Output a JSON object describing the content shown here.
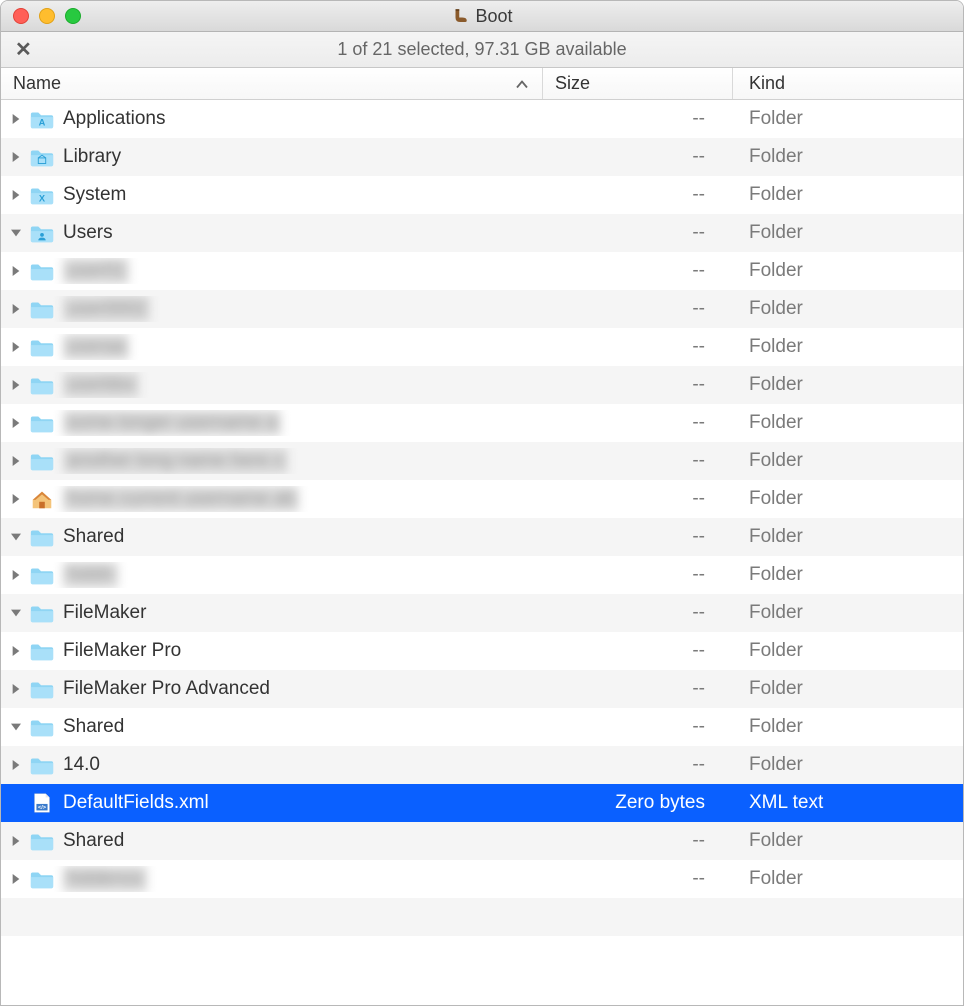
{
  "window": {
    "title": "Boot"
  },
  "status": "1 of 21 selected, 97.31 GB available",
  "columns": {
    "name": "Name",
    "size": "Size",
    "kind": "Kind"
  },
  "kinds": {
    "folder": "Folder",
    "xml": "XML text"
  },
  "sizes": {
    "dash": "--",
    "zero": "Zero bytes"
  },
  "rows": [
    {
      "indent": 0,
      "disc": "right",
      "icon": "folder-app",
      "label": "Applications",
      "blur": false,
      "size": "--",
      "kind": "Folder",
      "sel": false
    },
    {
      "indent": 0,
      "disc": "right",
      "icon": "folder-lib",
      "label": "Library",
      "blur": false,
      "size": "--",
      "kind": "Folder",
      "sel": false
    },
    {
      "indent": 0,
      "disc": "right",
      "icon": "folder-sys",
      "label": "System",
      "blur": false,
      "size": "--",
      "kind": "Folder",
      "sel": false
    },
    {
      "indent": 0,
      "disc": "down",
      "icon": "folder-usr",
      "label": "Users",
      "blur": false,
      "size": "--",
      "kind": "Folder",
      "sel": false
    },
    {
      "indent": 1,
      "disc": "right",
      "icon": "folder",
      "label": "user01",
      "blur": true,
      "size": "--",
      "kind": "Folder",
      "sel": false
    },
    {
      "indent": 1,
      "disc": "right",
      "icon": "folder",
      "label": "user0002",
      "blur": true,
      "size": "--",
      "kind": "Folder",
      "sel": false
    },
    {
      "indent": 1,
      "disc": "right",
      "icon": "folder",
      "label": "useraa",
      "blur": true,
      "size": "--",
      "kind": "Folder",
      "sel": false
    },
    {
      "indent": 1,
      "disc": "right",
      "icon": "folder",
      "label": "userbbx",
      "blur": true,
      "size": "--",
      "kind": "Folder",
      "sel": false
    },
    {
      "indent": 1,
      "disc": "right",
      "icon": "folder",
      "label": "some longer username a",
      "blur": true,
      "size": "--",
      "kind": "Folder",
      "sel": false
    },
    {
      "indent": 1,
      "disc": "right",
      "icon": "folder",
      "label": "another long name here x",
      "blur": true,
      "size": "--",
      "kind": "Folder",
      "sel": false
    },
    {
      "indent": 1,
      "disc": "right",
      "icon": "home",
      "label": "home current username ab",
      "blur": true,
      "size": "--",
      "kind": "Folder",
      "sel": false
    },
    {
      "indent": 1,
      "disc": "down",
      "icon": "folder",
      "label": "Shared",
      "blur": false,
      "size": "--",
      "kind": "Folder",
      "sel": false
    },
    {
      "indent": 2,
      "disc": "right",
      "icon": "folder",
      "label": "hiddn",
      "blur": true,
      "size": "--",
      "kind": "Folder",
      "sel": false
    },
    {
      "indent": 2,
      "disc": "down",
      "icon": "folder",
      "label": "FileMaker",
      "blur": false,
      "size": "--",
      "kind": "Folder",
      "sel": false
    },
    {
      "indent": 3,
      "disc": "right",
      "icon": "folder",
      "label": "FileMaker Pro",
      "blur": false,
      "size": "--",
      "kind": "Folder",
      "sel": false
    },
    {
      "indent": 3,
      "disc": "right",
      "icon": "folder",
      "label": "FileMaker Pro Advanced",
      "blur": false,
      "size": "--",
      "kind": "Folder",
      "sel": false
    },
    {
      "indent": 3,
      "disc": "down",
      "icon": "folder",
      "label": "Shared",
      "blur": false,
      "size": "--",
      "kind": "Folder",
      "sel": false
    },
    {
      "indent": 4,
      "disc": "right",
      "icon": "folder",
      "label": "14.0",
      "blur": false,
      "size": "--",
      "kind": "Folder",
      "sel": false
    },
    {
      "indent": 4,
      "disc": "none",
      "icon": "xml",
      "label": "DefaultFields.xml",
      "blur": false,
      "size": "Zero bytes",
      "kind": "XML text",
      "sel": true
    },
    {
      "indent": 4,
      "disc": "right",
      "icon": "folder",
      "label": "Shared",
      "blur": false,
      "size": "--",
      "kind": "Folder",
      "sel": false
    },
    {
      "indent": 2,
      "disc": "right",
      "icon": "folder",
      "label": "hiddenxx",
      "blur": true,
      "size": "--",
      "kind": "Folder",
      "sel": false
    }
  ]
}
